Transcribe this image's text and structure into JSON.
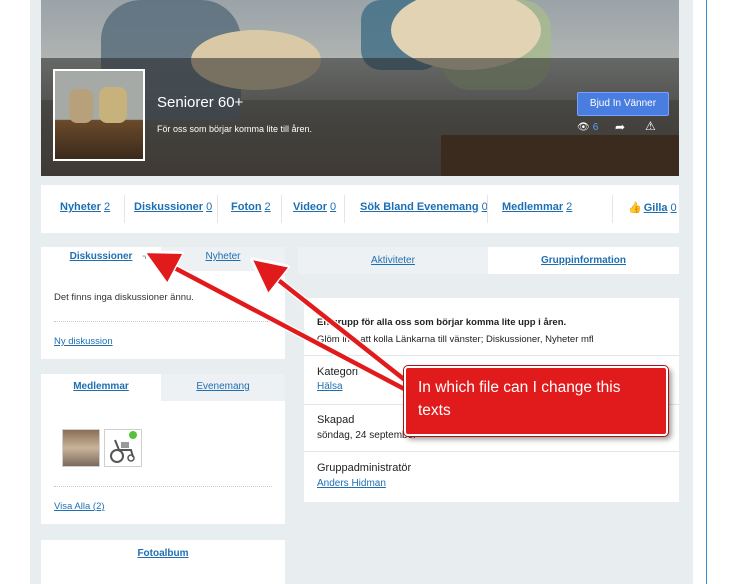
{
  "group": {
    "title": "Seniorer 60+",
    "description": "För oss som börjar komma lite till åren.",
    "invite_button": "Bjud In Vänner",
    "views_count": "6",
    "share_icon": "share-arrow-icon",
    "report_icon": "warning-triangle-icon"
  },
  "nav": {
    "items": [
      {
        "label": "Nyheter",
        "count": "2"
      },
      {
        "label": "Diskussioner",
        "count": "0"
      },
      {
        "label": "Foton",
        "count": "2"
      },
      {
        "label": "Videor",
        "count": "0"
      },
      {
        "label": "Sök Bland Evenemang",
        "count": "0"
      },
      {
        "label": "Medlemmar",
        "count": "2"
      }
    ],
    "like": {
      "icon": "thumbs-up-icon",
      "label": "Gilla",
      "count": "0"
    }
  },
  "discussions_widget": {
    "tabs": [
      "Diskussioner",
      "Nyheter"
    ],
    "add_symbol": "+",
    "empty_text": "Det finns inga diskussioner ännu.",
    "new_discussion_link": "Ny diskussion"
  },
  "members_widget": {
    "tabs": [
      "Medlemmar",
      "Evenemang"
    ],
    "view_all_link": "Visa Alla (2)"
  },
  "album_widget": {
    "title": "Fotoalbum"
  },
  "info_tabs": [
    "Aktiviteter",
    "Gruppinformation"
  ],
  "info": {
    "description_bold": "En grupp för alla oss som börjar komma lite upp i åren.",
    "description_sub": "Glöm inte att kolla Länkarna till vänster; Diskussioner, Nyheter mfl",
    "category_label": "Kategori",
    "category_value": "Hälsa",
    "created_label": "Skapad",
    "created_value": "söndag, 24 september",
    "admin_label": "Gruppadministratör",
    "admin_value": "Anders Hidman"
  },
  "annotation": {
    "callout_text": "In which file can I change this texts",
    "color": "#e11b1b"
  }
}
